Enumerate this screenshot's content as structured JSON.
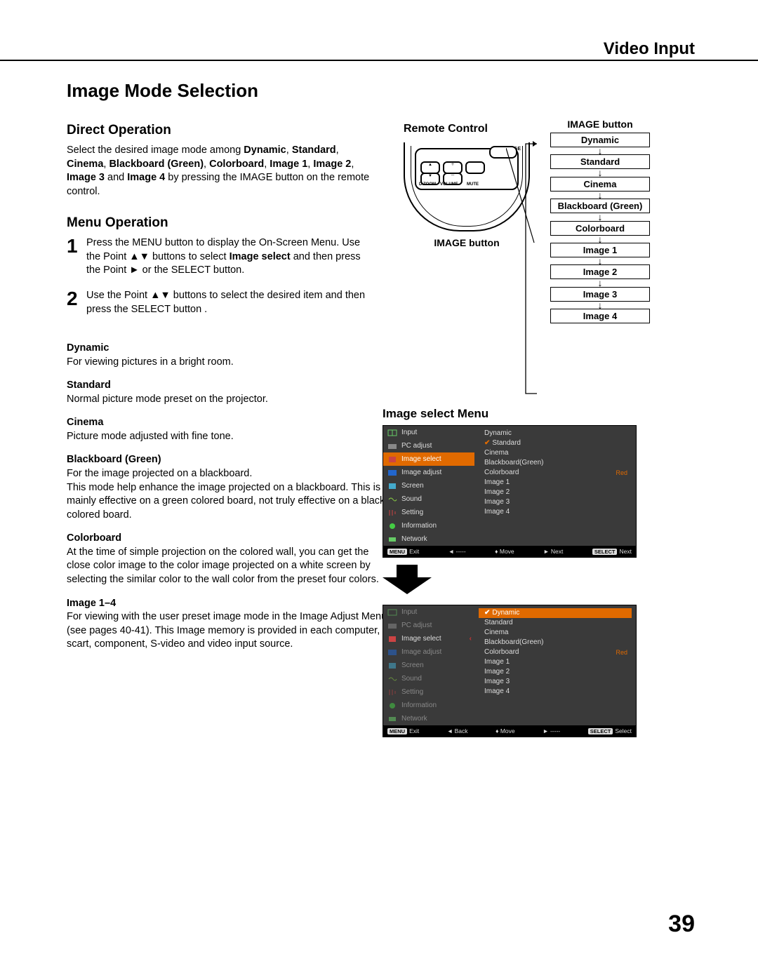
{
  "header": {
    "section_title": "Video Input"
  },
  "page_title": "Image Mode Selection",
  "direct_op": {
    "heading": "Direct Operation",
    "text_pre": "Select the desired image mode among ",
    "modes_inline": [
      "Dynamic",
      "Standard",
      "Cinema",
      "Blackboard (Green)",
      "Colorboard",
      "Image 1",
      "Image 2",
      "Image 3",
      "Image 4"
    ],
    "text_post": " by pressing the IMAGE button on the remote control."
  },
  "menu_op": {
    "heading": "Menu Operation",
    "steps": [
      {
        "num": "1",
        "pre": "Press the MENU button to display the On-Screen Menu. Use the Point ▲▼ buttons to select ",
        "bold": "Image  select",
        "post": " and then press the Point ► or the SELECT button."
      },
      {
        "num": "2",
        "pre": "Use the Point ▲▼ buttons to select  the desired item and then press the SELECT button .",
        "bold": "",
        "post": ""
      }
    ]
  },
  "remote": {
    "title": "Remote Control",
    "image_btn_label": "IMAGE button",
    "small_labels": {
      "image": "IMAGE",
      "dzoom": "D.ZOOM",
      "volume": "VOLUME",
      "mute": "MUTE"
    }
  },
  "flow": {
    "title": "IMAGE button",
    "items": [
      "Dynamic",
      "Standard",
      "Cinema",
      "Blackboard (Green)",
      "Colorboard",
      "Image 1",
      "Image 2",
      "Image 3",
      "Image 4"
    ]
  },
  "modes": [
    {
      "name": "Dynamic",
      "desc": "For viewing pictures in a bright room."
    },
    {
      "name": "Standard",
      "desc": "Normal picture mode preset on the projector."
    },
    {
      "name": "Cinema",
      "desc": "Picture mode adjusted with fine tone."
    },
    {
      "name": "Blackboard (Green)",
      "desc": "For the image projected on a blackboard.\nThis mode help enhance the image projected on a blackboard. This is mainly effective on a green colored board, not truly effective on a black colored board."
    },
    {
      "name": "Colorboard",
      "desc": "At the time of simple projection on the colored wall, you can get the close color image to the color image projected on a white screen by selecting the similar color to the wall color from the preset four colors."
    },
    {
      "name": "Image 1–4",
      "desc": "For viewing with the user preset image mode in the Image Adjust Menu (see pages 40-41). This Image memory is provided in each computer, scart, component, S-video and video input source."
    }
  ],
  "osd": {
    "title": "Image select Menu",
    "left_items": [
      "Input",
      "PC adjust",
      "Image select",
      "Image adjust",
      "Screen",
      "Sound",
      "Setting",
      "Information",
      "Network"
    ],
    "right_items": [
      "Dynamic",
      "Standard",
      "Cinema",
      "Blackboard(Green)",
      "Colorboard",
      "Image 1",
      "Image 2",
      "Image 3",
      "Image 4"
    ],
    "colorboard_side": "Red",
    "panel1": {
      "selected_left": "Image select",
      "checked_right": "Standard",
      "foot": [
        "MENU Exit",
        "◄ -----",
        "♦ Move",
        "► Next",
        "SELECT Next"
      ]
    },
    "panel2": {
      "selected_right": "Dynamic",
      "checked_right": "Dynamic",
      "foot": [
        "MENU Exit",
        "◄ Back",
        "♦ Move",
        "► -----",
        "SELECT Select"
      ]
    }
  },
  "page_number": "39"
}
